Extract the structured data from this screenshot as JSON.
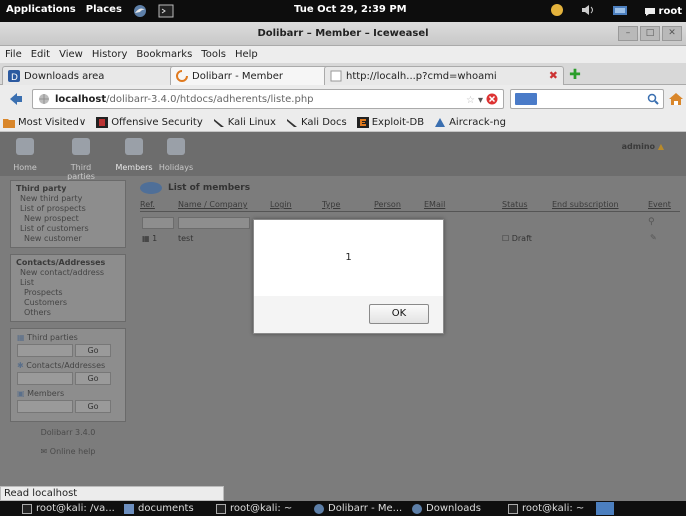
{
  "top_panel": {
    "applications": "Applications",
    "places": "Places",
    "clock": "Tue Oct 29,  2:39 PM",
    "user": "root"
  },
  "window": {
    "title": "Dolibarr – Member – Iceweasel"
  },
  "menubar": [
    "File",
    "Edit",
    "View",
    "History",
    "Bookmarks",
    "Tools",
    "Help"
  ],
  "tabs": [
    {
      "label": "Downloads area"
    },
    {
      "label": "Dolibarr - Member"
    },
    {
      "label": "http://localh...p?cmd=whoami"
    }
  ],
  "navbar": {
    "url_host": "localhost",
    "url_path": "/dolibarr-3.4.0/htdocs/adherents/liste.php"
  },
  "bookmarks": [
    "Most Visited∨",
    "Offensive Security",
    "Kali Linux",
    "Kali Docs",
    "Exploit-DB",
    "Aircrack-ng"
  ],
  "dolibarr": {
    "top_menu": [
      "Home",
      "Third parties",
      "Members",
      "Holidays"
    ],
    "login": "admino",
    "left_menu": {
      "thirdparty": {
        "title": "Third party",
        "items": [
          "New third party",
          "List of prospects",
          "New prospect",
          "List of customers",
          "New customer"
        ]
      },
      "contacts": {
        "title": "Contacts/Addresses",
        "items": [
          "New contact/address",
          "List",
          "Prospects",
          "Customers",
          "Others"
        ]
      }
    },
    "search": {
      "thirdparties": "Third parties",
      "contacts": "Contacts/Addresses",
      "members": "Members",
      "go": "Go"
    },
    "version": "Dolibarr 3.4.0",
    "online_help": "Online help",
    "list_title": "List of members",
    "columns": [
      "Ref.",
      "Name / Company",
      "Login",
      "Type",
      "Person",
      "EMail",
      "Status",
      "End subscription",
      "Event"
    ],
    "row": {
      "ref": "1",
      "name": "test",
      "status": "Draft"
    }
  },
  "dialog": {
    "message": "1",
    "ok": "OK"
  },
  "statusbar": {
    "text": "Read localhost"
  },
  "taskbar": [
    "root@kali: /va...",
    "documents",
    "root@kali: ~",
    "Dolibarr - Me...",
    "Downloads",
    "root@kali: ~"
  ]
}
